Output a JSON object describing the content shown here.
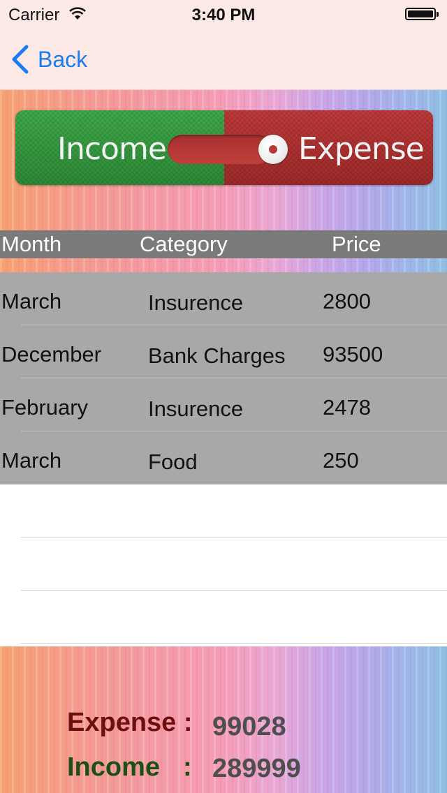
{
  "status_bar": {
    "carrier": "Carrier",
    "time": "3:40 PM"
  },
  "nav": {
    "back_label": "Back"
  },
  "toggle": {
    "income_label": "Income",
    "expense_label": "Expense",
    "selected": "Expense"
  },
  "table": {
    "headers": [
      "Month",
      "Category",
      "Price"
    ],
    "rows": [
      {
        "month": "March",
        "category": "Insurence",
        "price": "2800"
      },
      {
        "month": "December",
        "category": "Bank Charges",
        "price": "93500"
      },
      {
        "month": "February",
        "category": "Insurence",
        "price": "2478"
      },
      {
        "month": "March",
        "category": "Food",
        "price": "250"
      }
    ]
  },
  "summary": {
    "expense_label": "Expense :",
    "expense_value": "99028",
    "income_label": "Income",
    "income_colon": ":",
    "income_value": "289999"
  },
  "colors": {
    "accent_blue": "#1b7cf2",
    "income_green": "#2d8a37",
    "expense_red": "#b33a3a",
    "header_gray": "#7a7a7a",
    "row_gray": "#a8a8a8"
  }
}
